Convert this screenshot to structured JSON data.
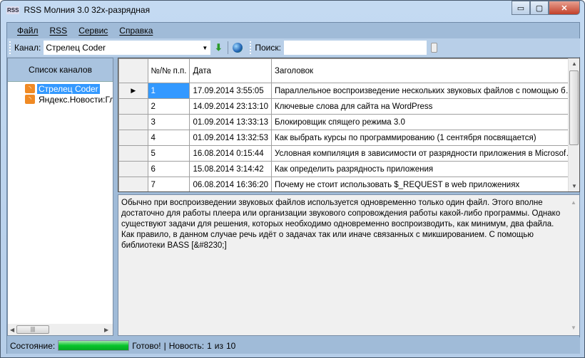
{
  "window": {
    "title": "RSS Молния 3.0 32x-разрядная",
    "icon": "RSS",
    "minimize": "▭",
    "maximize": "▢",
    "close": "✕"
  },
  "menu": [
    "Файл",
    "RSS",
    "Сервис",
    "Справка"
  ],
  "toolbar": {
    "channel_label": "Канал:",
    "channel_value": "Стрелец Coder",
    "search_label": "Поиск:",
    "search_value": ""
  },
  "sidebar": {
    "header": "Список каналов",
    "items": [
      {
        "label": "Стрелец Coder",
        "selected": true
      },
      {
        "label": "Яндекс.Новости:Главное"
      }
    ]
  },
  "grid": {
    "columns": [
      "№/№ п.п.",
      "Дата",
      "Заголовок"
    ],
    "rows": [
      [
        "1",
        "17.09.2014 3:55:05",
        "Параллельное воспроизведение нескольких звуковых файлов с помощью библ..."
      ],
      [
        "2",
        "14.09.2014 23:13:10",
        "Ключевые слова для сайта на WordPress"
      ],
      [
        "3",
        "01.09.2014 13:33:13",
        "Блокировщик спящего режима 3.0"
      ],
      [
        "4",
        "01.09.2014 13:32:53",
        "Как выбрать курсы по программированию (1 сентября посвящается)"
      ],
      [
        "5",
        "16.08.2014 0:15:44",
        "Условная компиляция в зависимости от разрядности приложения в Microsoft Vi..."
      ],
      [
        "6",
        "15.08.2014 3:14:42",
        "Как определить разрядность приложения"
      ],
      [
        "7",
        "06.08.2014 16:36:20",
        "Почему не стоит использовать $_REQUEST в web приложениях"
      ]
    ]
  },
  "description": "Обычно при воспроизведении звуковых файлов используется одновременно только один файл. Этого вполне достаточно для работы плеера или организации звукового сопровождения работы какой-либо программы. Однако существуют задачи для решения, которых необходимо одновременно воспроизводить, как минимум, два файла. Как правило, в данном случае речь идёт о задачах так или иначе связанных с микшированием. С помощью библиотеки BASS [&#8230;]",
  "status": {
    "label": "Состояние:",
    "progress": 100,
    "progress_color": "#08c42b",
    "state": "Готово!",
    "sep": "|",
    "news_label": "Новость:",
    "current": "1",
    "of": "из",
    "total": "10"
  }
}
